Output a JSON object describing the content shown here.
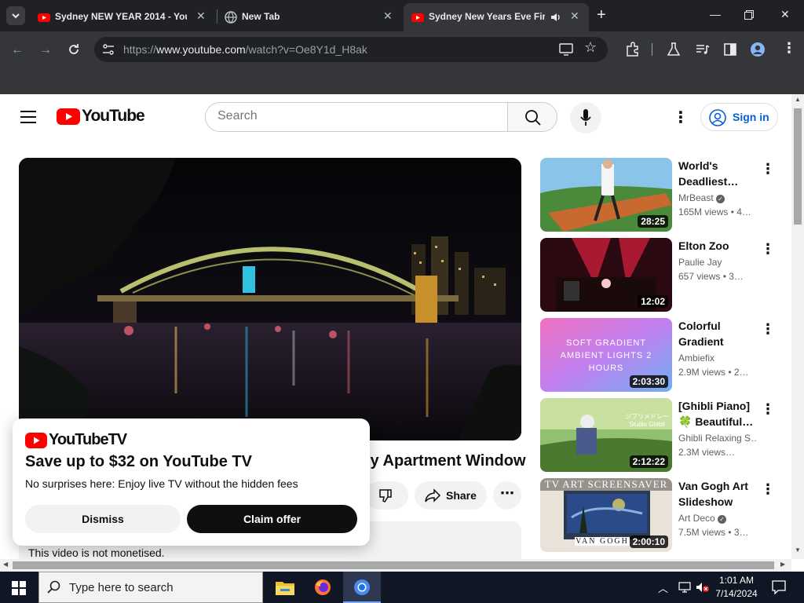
{
  "browser": {
    "tabs": [
      {
        "title": "Sydney NEW YEAR 2014 - YouT",
        "active": false
      },
      {
        "title": "New Tab",
        "active": false
      },
      {
        "title": "Sydney New Years Eve Fire",
        "active": true
      }
    ],
    "url_prefix": "https://",
    "url_host": "www.youtube.com",
    "url_path": "/watch?v=Oe8Y1d_H8ak"
  },
  "youtube": {
    "logo_text": "YouTube",
    "search_placeholder": "Search",
    "sign_in_label": "Sign in",
    "video_title_visible": "ly Apartment Window",
    "share_label": "Share",
    "monetisation_note": "This video is not monetised.",
    "accent_color": "#ff0000"
  },
  "popup": {
    "brand": "YouTubeTV",
    "headline": "Save up to $32 on YouTube TV",
    "subtext": "No surprises here: Enjoy live TV without the hidden fees",
    "dismiss_label": "Dismiss",
    "claim_label": "Claim offer"
  },
  "recommendations": [
    {
      "title": "World's Deadliest…",
      "channel": "MrBeast",
      "verified": true,
      "meta": "165M views • 4…",
      "duration": "28:25"
    },
    {
      "title": "Elton Zoo",
      "channel": "Paulie Jay",
      "verified": false,
      "meta": "657 views • 3…",
      "duration": "12:02"
    },
    {
      "title": "Colorful Gradient Wav…",
      "channel": "Ambiefix",
      "verified": false,
      "meta": "2.9M views • 2…",
      "duration": "2:03:30",
      "thumb_text": "SOFT GRADIENT AMBIENT LIGHTS 2 HOURS"
    },
    {
      "title": "[Ghibli Piano] 🍀 Beautiful…",
      "channel": "Ghibli Relaxing S…",
      "verified": false,
      "meta": "2.3M views…",
      "duration": "2:12:22",
      "thumb_text": "ジブリメドレー Studio Ghibli"
    },
    {
      "title": "Van Gogh Art Slideshow for…",
      "channel": "Art Deco",
      "verified": true,
      "meta": "7.5M views • 3…",
      "duration": "2:00:10",
      "thumb_text": "TV ART SCREENSAVER",
      "thumb_text2": "VAN GOGH"
    }
  ],
  "taskbar": {
    "search_placeholder": "Type here to search",
    "time": "1:01 AM",
    "date": "7/14/2024"
  }
}
